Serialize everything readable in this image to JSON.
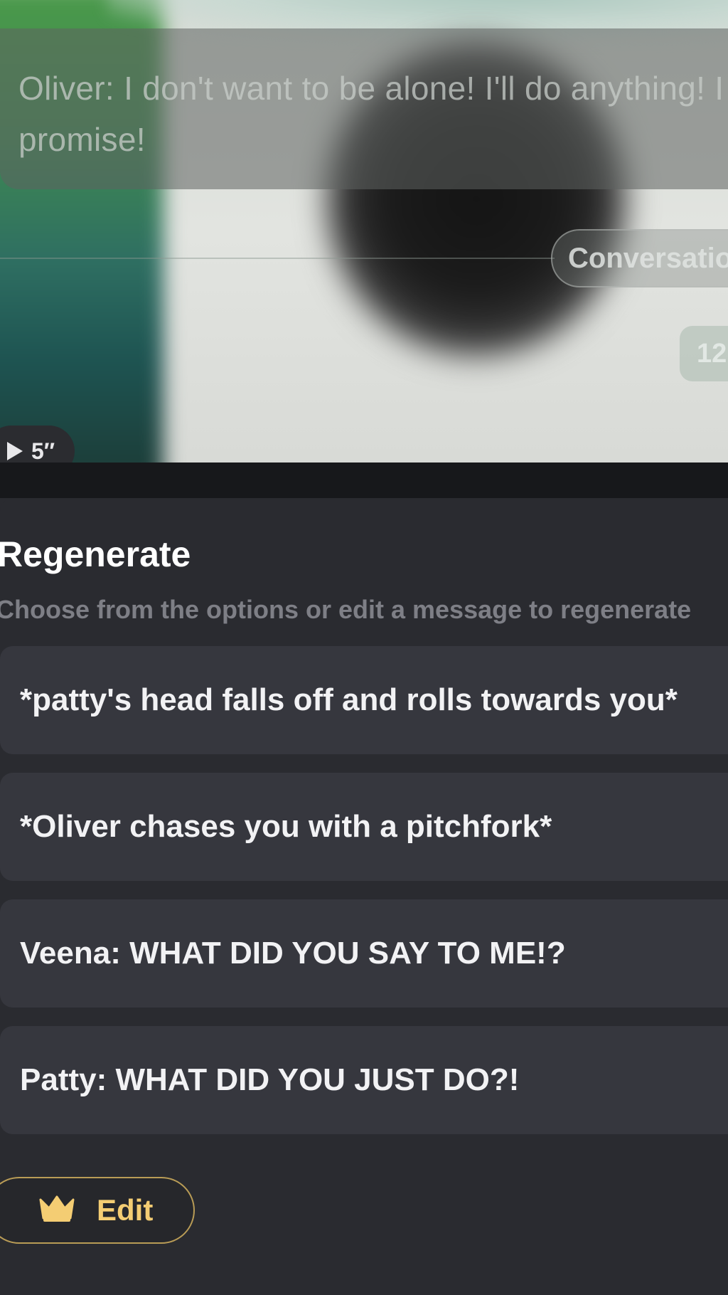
{
  "chat": {
    "message_text": "Oliver: I don't want to be alone! I'll do anything! I promise!",
    "conversation_label": "Conversation",
    "counter_text": "12",
    "duration_text": "5″"
  },
  "sheet": {
    "title": "Regenerate",
    "subtitle": "Choose from the options or edit a message to regenerate",
    "options": [
      {
        "label": "*patty's head falls off and rolls towards you*"
      },
      {
        "label": "*Oliver chases you with a pitchfork*"
      },
      {
        "label": "Veena: WHAT DID YOU SAY TO ME!?"
      },
      {
        "label": "Patty: WHAT DID YOU JUST DO?!"
      }
    ],
    "edit_label": "Edit"
  },
  "colors": {
    "sheet_background": "#2a2b30",
    "option_background": "#36373e",
    "accent_gold": "#f4cd73",
    "subtitle_gray": "#7e7f86"
  },
  "icons": {
    "edit": "crown-icon",
    "duration": "play-icon"
  }
}
